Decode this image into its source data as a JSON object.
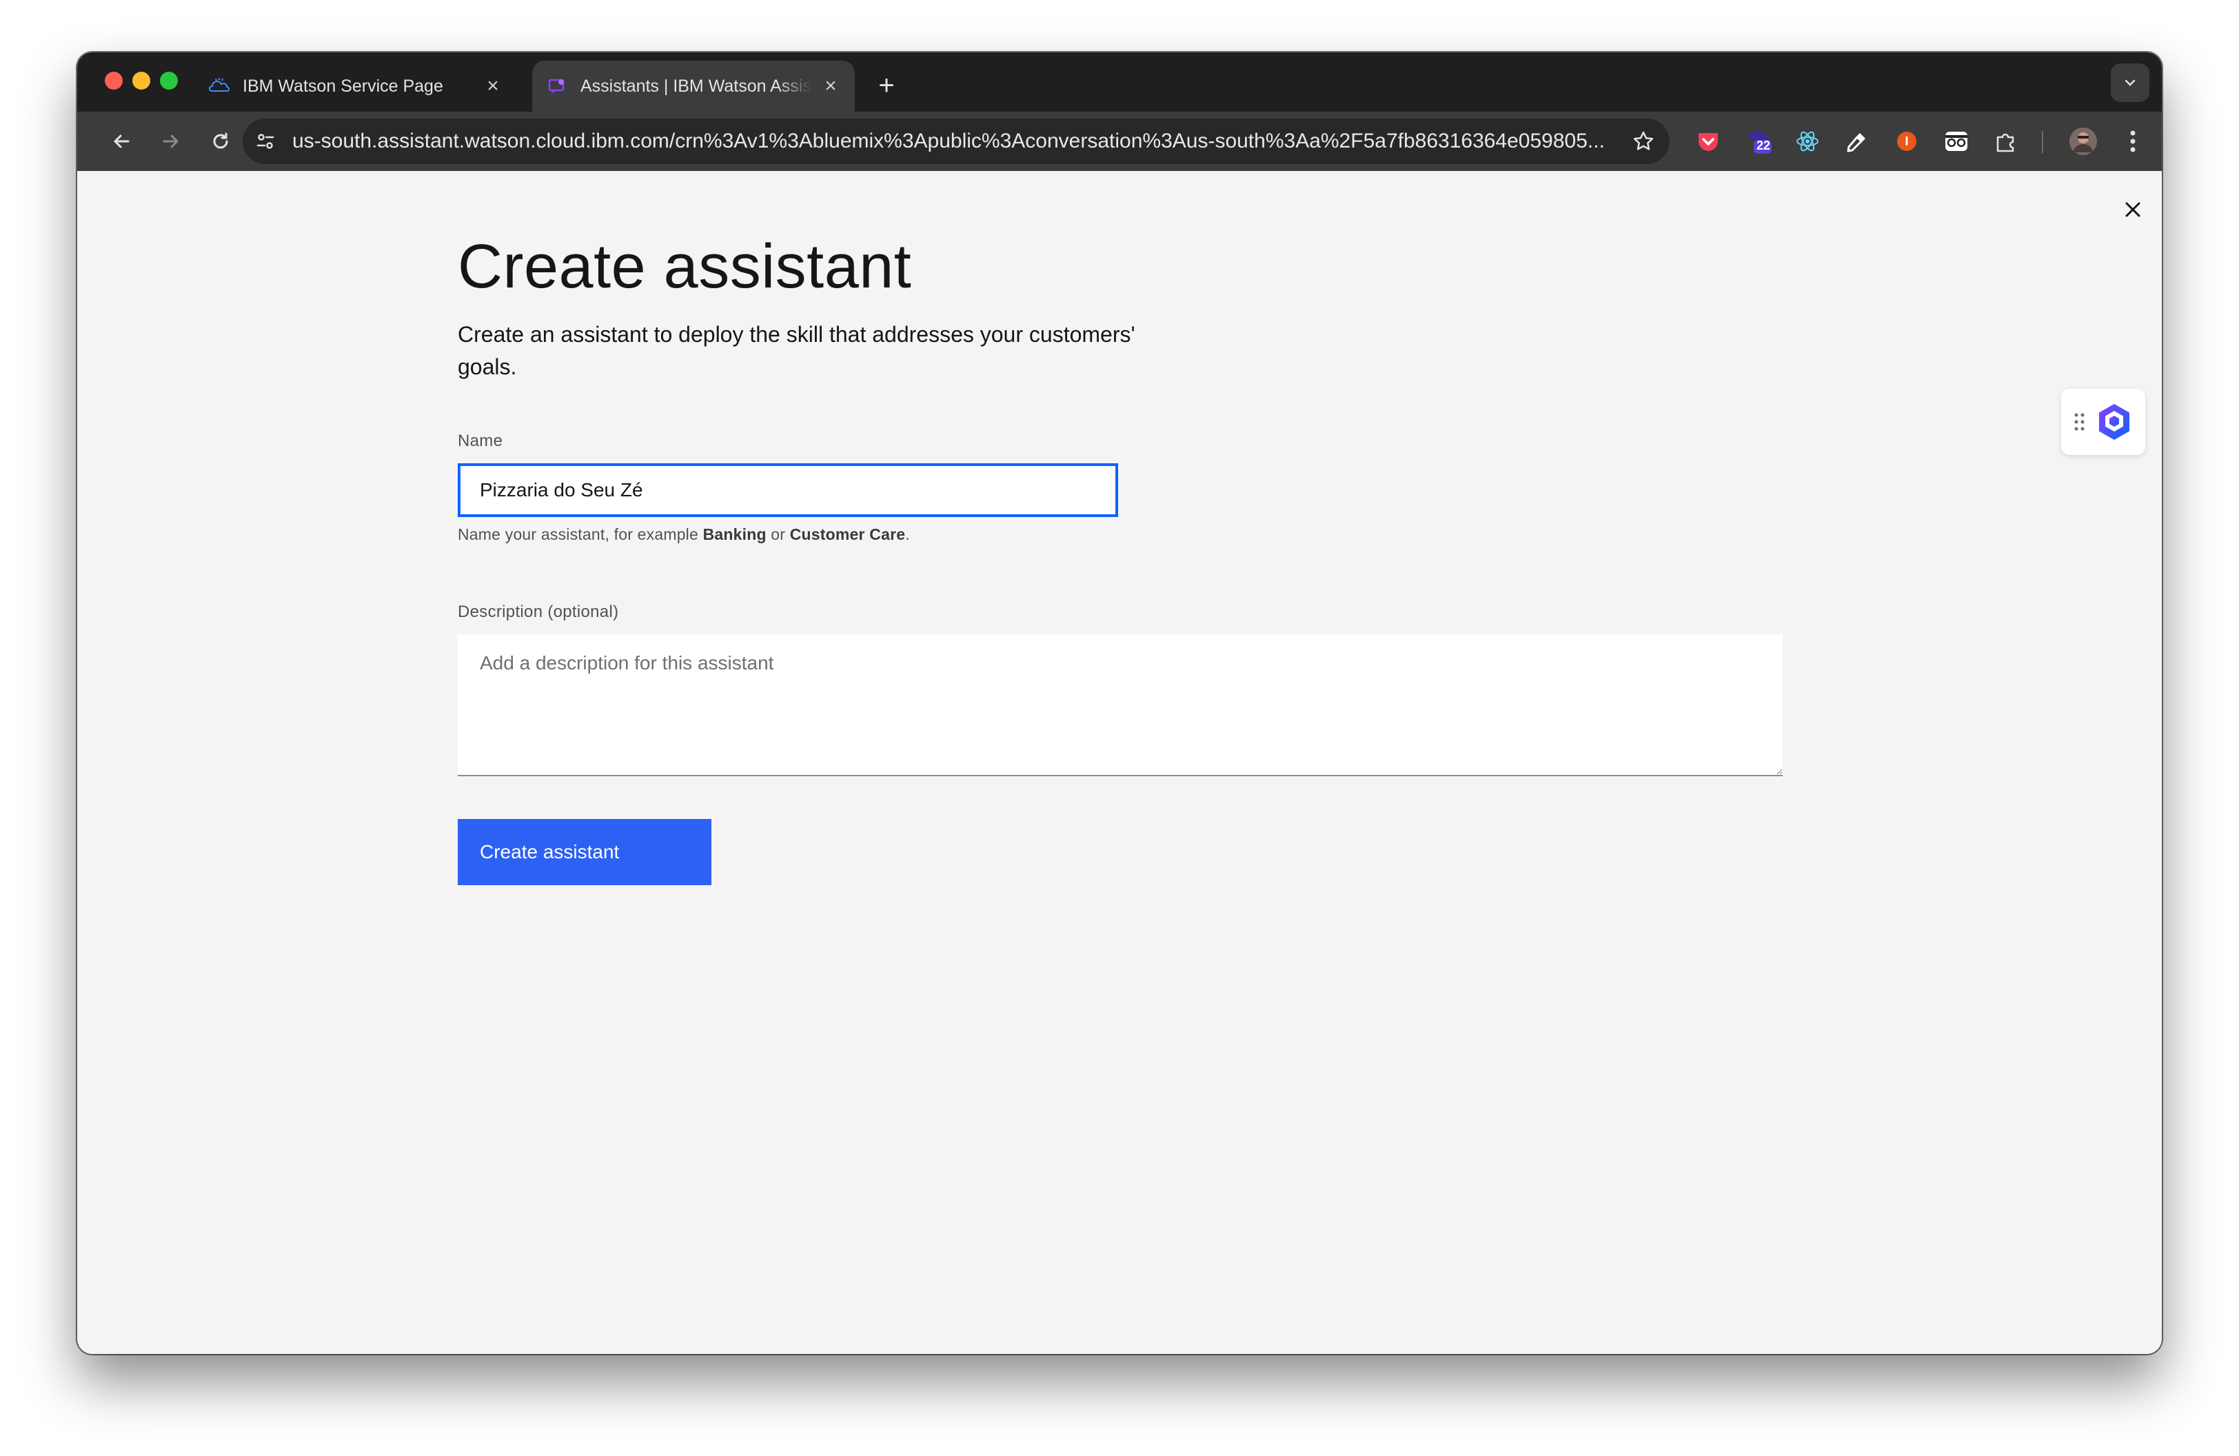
{
  "browser": {
    "tabs": [
      {
        "title": "IBM Watson Service Page",
        "active": false,
        "icon": "ibm-cloud-icon"
      },
      {
        "title": "Assistants | IBM Watson Assistant",
        "active": true,
        "icon": "watson-assistant-icon"
      }
    ],
    "new_tab_label": "+",
    "url": "us-south.assistant.watson.cloud.ibm.com/crn%3Av1%3Abluemix%3Apublic%3Aconversation%3Aus-south%3Aa%2F5a7fb86316364e059805...",
    "extensions": [
      {
        "name": "pocket-icon"
      },
      {
        "name": "badge-extension-icon",
        "badge": "22"
      },
      {
        "name": "react-devtools-icon"
      },
      {
        "name": "eyedropper-icon"
      },
      {
        "name": "ext-orange-icon",
        "letter": "I"
      },
      {
        "name": "glasses-icon"
      },
      {
        "name": "extensions-puzzle-icon"
      },
      {
        "name": "profile-avatar"
      },
      {
        "name": "menu-kebab-icon"
      }
    ],
    "colors": {
      "tab_strip": "#1f1f1f",
      "toolbar": "#3c3c3c",
      "omnibox": "#282828"
    }
  },
  "page": {
    "title": "Create assistant",
    "intro": "Create an assistant to deploy the skill that addresses your customers' goals.",
    "name_field": {
      "label": "Name",
      "value": "Pizzaria do Seu Zé",
      "helper_prefix": "Name your assistant, for example ",
      "helper_example1": "Banking",
      "helper_or": " or ",
      "helper_example2": "Customer Care",
      "helper_suffix": "."
    },
    "description_field": {
      "label": "Description (optional)",
      "placeholder": "Add a description for this assistant",
      "value": ""
    },
    "submit_label": "Create assistant",
    "colors": {
      "primary": "#0f62fe",
      "background": "#f4f4f4",
      "text": "#161616"
    }
  }
}
